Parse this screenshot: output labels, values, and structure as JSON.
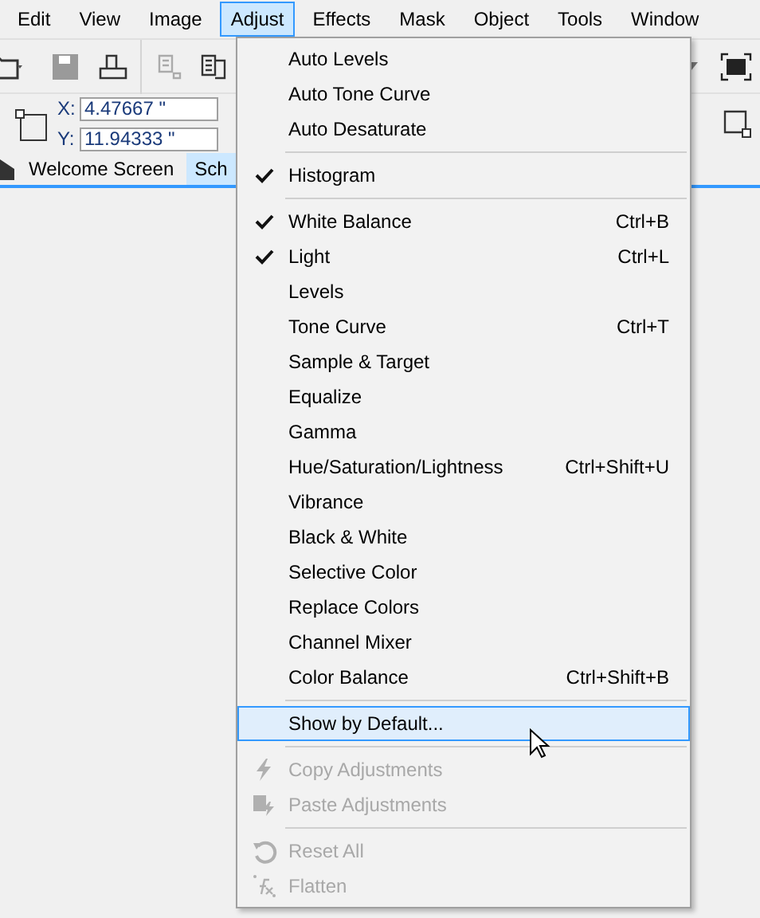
{
  "menubar": [
    {
      "label": "Edit",
      "selected": false
    },
    {
      "label": "View",
      "selected": false
    },
    {
      "label": "Image",
      "selected": false
    },
    {
      "label": "Adjust",
      "selected": true
    },
    {
      "label": "Effects",
      "selected": false
    },
    {
      "label": "Mask",
      "selected": false
    },
    {
      "label": "Object",
      "selected": false
    },
    {
      "label": "Tools",
      "selected": false
    },
    {
      "label": "Window",
      "selected": false
    }
  ],
  "position": {
    "x_label": "X:",
    "x_value": "4.47667 \"",
    "y_label": "Y:",
    "y_value": "11.94333 \""
  },
  "tabs": [
    {
      "label": "Welcome Screen",
      "selected": false
    },
    {
      "label": "Sch",
      "selected": true
    }
  ],
  "menu": [
    {
      "kind": "item",
      "label": "Auto Levels",
      "checked": false,
      "disabled": false,
      "selected": false
    },
    {
      "kind": "item",
      "label": "Auto Tone Curve",
      "checked": false,
      "disabled": false,
      "selected": false
    },
    {
      "kind": "item",
      "label": "Auto Desaturate",
      "checked": false,
      "disabled": false,
      "selected": false
    },
    {
      "kind": "separator"
    },
    {
      "kind": "item",
      "label": "Histogram",
      "checked": true,
      "disabled": false,
      "selected": false
    },
    {
      "kind": "separator"
    },
    {
      "kind": "item",
      "label": "White Balance",
      "shortcut": "Ctrl+B",
      "checked": true,
      "disabled": false,
      "selected": false
    },
    {
      "kind": "item",
      "label": "Light",
      "shortcut": "Ctrl+L",
      "checked": true,
      "disabled": false,
      "selected": false
    },
    {
      "kind": "item",
      "label": "Levels",
      "checked": false,
      "disabled": false,
      "selected": false
    },
    {
      "kind": "item",
      "label": "Tone Curve",
      "shortcut": "Ctrl+T",
      "checked": false,
      "disabled": false,
      "selected": false
    },
    {
      "kind": "item",
      "label": "Sample & Target",
      "checked": false,
      "disabled": false,
      "selected": false
    },
    {
      "kind": "item",
      "label": "Equalize",
      "checked": false,
      "disabled": false,
      "selected": false
    },
    {
      "kind": "item",
      "label": "Gamma",
      "checked": false,
      "disabled": false,
      "selected": false
    },
    {
      "kind": "item",
      "label": "Hue/Saturation/Lightness",
      "shortcut": "Ctrl+Shift+U",
      "checked": false,
      "disabled": false,
      "selected": false
    },
    {
      "kind": "item",
      "label": "Vibrance",
      "checked": false,
      "disabled": false,
      "selected": false
    },
    {
      "kind": "item",
      "label": "Black & White",
      "checked": false,
      "disabled": false,
      "selected": false
    },
    {
      "kind": "item",
      "label": "Selective Color",
      "checked": false,
      "disabled": false,
      "selected": false
    },
    {
      "kind": "item",
      "label": "Replace Colors",
      "checked": false,
      "disabled": false,
      "selected": false
    },
    {
      "kind": "item",
      "label": "Channel Mixer",
      "checked": false,
      "disabled": false,
      "selected": false
    },
    {
      "kind": "item",
      "label": "Color Balance",
      "shortcut": "Ctrl+Shift+B",
      "checked": false,
      "disabled": false,
      "selected": false
    },
    {
      "kind": "separator"
    },
    {
      "kind": "item",
      "label": "Show by Default...",
      "checked": false,
      "disabled": false,
      "selected": true
    },
    {
      "kind": "separator"
    },
    {
      "kind": "item",
      "label": "Copy Adjustments",
      "checked": false,
      "disabled": true,
      "selected": false
    },
    {
      "kind": "item",
      "label": "Paste Adjustments",
      "checked": false,
      "disabled": true,
      "selected": false
    },
    {
      "kind": "separator"
    },
    {
      "kind": "item",
      "label": "Reset All",
      "checked": false,
      "disabled": true,
      "selected": false
    },
    {
      "kind": "item",
      "label": "Flatten",
      "checked": false,
      "disabled": true,
      "selected": false
    }
  ]
}
